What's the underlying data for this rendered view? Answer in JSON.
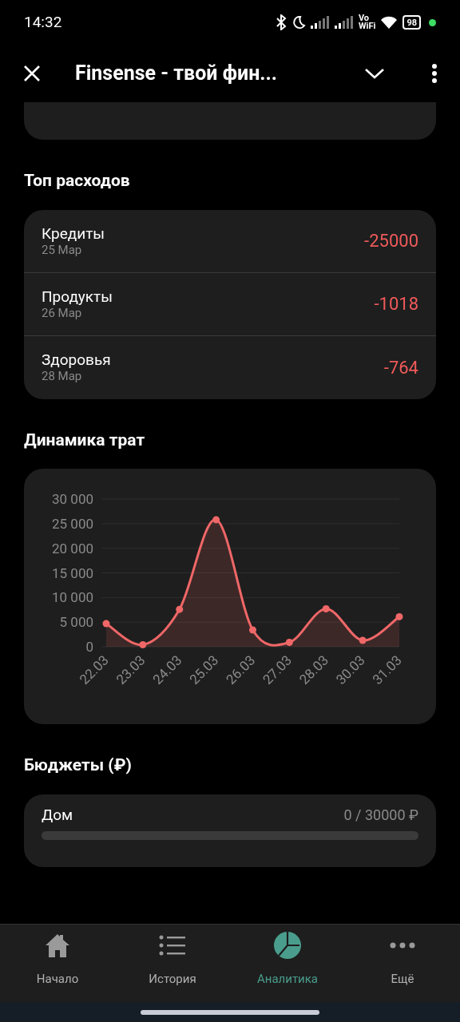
{
  "status_bar": {
    "time": "14:32",
    "network_label": "Vo WiFi",
    "battery": "98"
  },
  "header": {
    "title": "Finsense - твой фин..."
  },
  "top_expenses": {
    "title": "Топ расходов",
    "items": [
      {
        "name": "Кредиты",
        "date": "25 Мар",
        "amount": "-25000"
      },
      {
        "name": "Продукты",
        "date": "26 Мар",
        "amount": "-1018"
      },
      {
        "name": "Здоровья",
        "date": "28 Мар",
        "amount": "-764"
      }
    ]
  },
  "dynamics": {
    "title": "Динамика трат",
    "chart_data": {
      "type": "area",
      "categories": [
        "22.03",
        "23.03",
        "24.03",
        "25.03",
        "26.03",
        "27.03",
        "28.03",
        "30.03",
        "31.03"
      ],
      "grid": true,
      "series": [
        {
          "color": "#f06767",
          "values": [
            4700,
            400,
            7600,
            25800,
            3400,
            900,
            7700,
            1300,
            6100
          ]
        }
      ],
      "ylim": [
        0,
        30000
      ],
      "yticks": [
        {
          "value": 0,
          "label": "0"
        },
        {
          "value": 5000,
          "label": "5 000"
        },
        {
          "value": 10000,
          "label": "10 000"
        },
        {
          "value": 15000,
          "label": "15 000"
        },
        {
          "value": 20000,
          "label": "20 000"
        },
        {
          "value": 25000,
          "label": "25 000"
        },
        {
          "value": 30000,
          "label": "30 000"
        }
      ]
    }
  },
  "budgets": {
    "title": "Бюджеты (₽)",
    "items": [
      {
        "name": "Дом",
        "amount": "0 / 30000 ₽",
        "level": 0
      }
    ]
  },
  "nav": [
    {
      "label": "Начало",
      "selected": false
    },
    {
      "label": "История",
      "selected": false
    },
    {
      "label": "Аналитика",
      "selected": true
    },
    {
      "label": "Ещё",
      "selected": false
    }
  ]
}
